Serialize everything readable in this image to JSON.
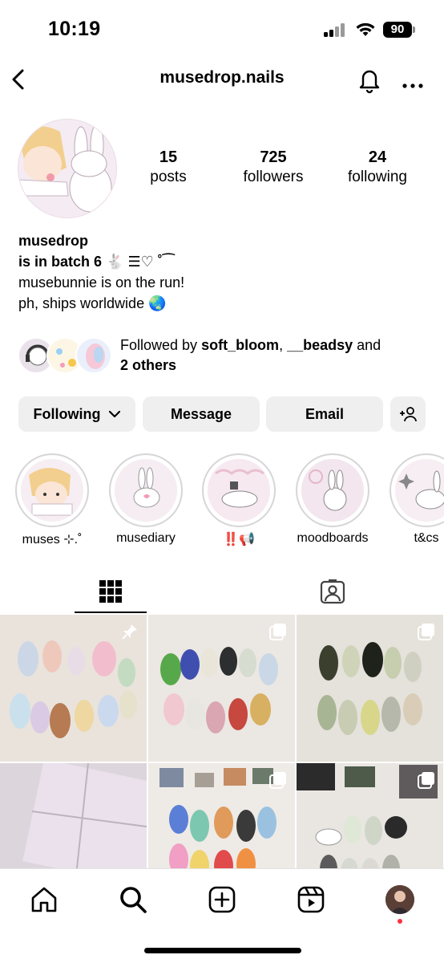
{
  "status_bar": {
    "time": "10:19",
    "battery": "90"
  },
  "header": {
    "title": "musedrop.nails"
  },
  "profile": {
    "stats": [
      {
        "num": "15",
        "label": "posts"
      },
      {
        "num": "725",
        "label": "followers"
      },
      {
        "num": "24",
        "label": "following"
      }
    ],
    "name": "musedrop",
    "bio_line1": "is in batch 6 🐇 ☰♡ ˚⁀",
    "bio_line2": "musebunnie is on the run!",
    "bio_line3": "ph, ships worldwide 🌏"
  },
  "followed_by": {
    "prefix": "Followed by ",
    "user1": "soft_bloom",
    "sep": ", ",
    "user2": "__beadsy",
    "and": " and",
    "others": "2 others"
  },
  "actions": {
    "following": "Following",
    "message": "Message",
    "email": "Email"
  },
  "highlights": [
    {
      "label": "muses ⊹.˚"
    },
    {
      "label": "musediary"
    },
    {
      "label": "‼️📢"
    },
    {
      "label": "moodboards"
    },
    {
      "label": "t&cs"
    }
  ],
  "colors": {
    "button_bg": "#efefef",
    "notification_dot": "#ff3040",
    "highlight_ring": "#d6d6d6"
  },
  "icons": {
    "back": "chevron-left-icon",
    "bell": "bell-icon",
    "more": "more-horizontal-icon",
    "grid": "grid-icon",
    "tagged": "tagged-person-icon",
    "home": "home-icon",
    "search": "search-icon",
    "create": "plus-square-icon",
    "reels": "reels-icon",
    "pin": "pin-icon",
    "multi": "carousel-icon"
  }
}
